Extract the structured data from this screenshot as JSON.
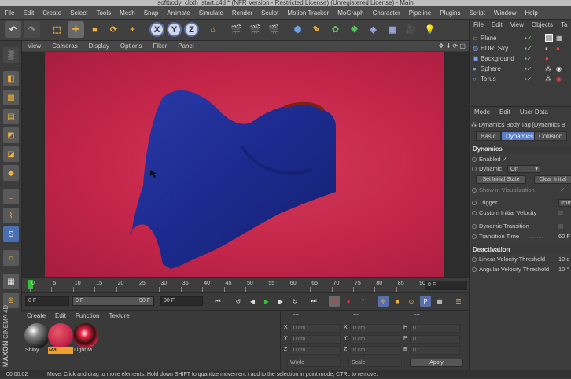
{
  "window": {
    "title": "softbody_cloth_start.c4d * (NFR Version - Restricted License) (Unregistered License) - Main"
  },
  "menu": [
    "File",
    "Edit",
    "Create",
    "Select",
    "Tools",
    "Mesh",
    "Snap",
    "Animate",
    "Simulate",
    "Render",
    "Sculpt",
    "Motion Tracker",
    "MoGraph",
    "Character",
    "Pipeline",
    "Plugins",
    "Script",
    "Window",
    "Help"
  ],
  "toolbar": {
    "x": "X",
    "y": "Y",
    "z": "Z"
  },
  "viewport": {
    "menu": [
      "View",
      "Cameras",
      "Display",
      "Options",
      "Filter",
      "Panel"
    ]
  },
  "timeline": {
    "ticks": [
      "0",
      "5",
      "10",
      "15",
      "20",
      "25",
      "30",
      "35",
      "40",
      "45",
      "50",
      "55",
      "60",
      "65",
      "70",
      "75",
      "80",
      "85",
      "90"
    ],
    "current_frame": "0 F"
  },
  "transport": {
    "start": "0 F",
    "range_start": "0 F",
    "range_end": "90 F",
    "end": "90 F"
  },
  "materials": {
    "menu": [
      "Create",
      "Edit",
      "Function",
      "Texture"
    ],
    "items": [
      {
        "name": "Shiny"
      },
      {
        "name": "Mat"
      },
      {
        "name": "Light M"
      }
    ]
  },
  "coordinates": {
    "header_left": "---",
    "header_mid": "---",
    "header_right": "---",
    "rows": [
      {
        "a": "X",
        "av": "0 cm",
        "b": "X",
        "bv": "0 cm",
        "c": "H",
        "cv": "0 °"
      },
      {
        "a": "Y",
        "av": "0 cm",
        "b": "Y",
        "bv": "0 cm",
        "c": "P",
        "cv": "0 °"
      },
      {
        "a": "Z",
        "av": "0 cm",
        "b": "Z",
        "bv": "0 cm",
        "c": "B",
        "cv": "0 °"
      }
    ],
    "world": "World",
    "scale": "Scale",
    "apply": "Apply"
  },
  "status": {
    "time": "00:00:02",
    "message": "Move: Click and drag to move elements. Hold down SHIFT to quantize movement / add to the selection in point mode, CTRL to remove."
  },
  "objects": {
    "menu": [
      "File",
      "Edit",
      "View",
      "Objects",
      "Ta"
    ],
    "items": [
      {
        "name": "Plane"
      },
      {
        "name": "HDRI Sky"
      },
      {
        "name": "Background"
      },
      {
        "name": "Sphere"
      },
      {
        "name": "Torus"
      }
    ]
  },
  "attributes": {
    "menu": [
      "Mode",
      "Edit",
      "User Data"
    ],
    "tag_title": "Dynamics Body Tag [Dynamics B",
    "tabs": [
      "Basic",
      "Dynamics",
      "Collision"
    ],
    "section_dynamics": "Dynamics",
    "enabled": "Enabled",
    "enabled_check": "✓",
    "dynamic": "Dynamic",
    "dynamic_value": "On",
    "set_initial": "Set Initial State",
    "clear_initial": "Clear Initial",
    "show_in_vis": "Show in Visualization",
    "trigger": "Trigger",
    "trigger_value": "Imm",
    "custom_initial_velocity": "Custom Initial Velocity",
    "dynamic_transition": "Dynamic Transition",
    "transition_time": "Transition Time",
    "transition_time_value": "60 F",
    "section_deactivation": "Deactivation",
    "linear_velocity": "Linear Velocity Threshold",
    "linear_value": "10 c",
    "angular_velocity": "Angular Velocity Threshold",
    "angular_value": "10 °"
  },
  "brand": {
    "maxon": "MAXON",
    "cinema": "CINEMA 4D"
  },
  "colors": {
    "accent": "#5b7ec8",
    "viewport_bg": "#c4264a",
    "cloth": "#1a2a8c"
  }
}
